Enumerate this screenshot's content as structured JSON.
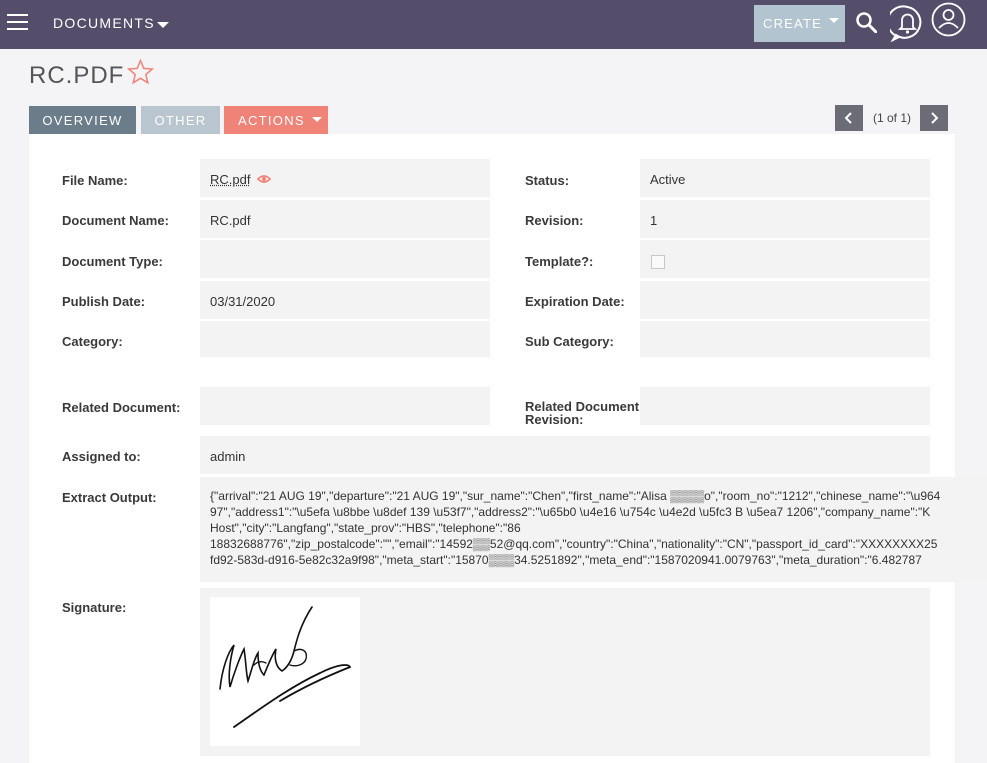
{
  "topbar": {
    "module_label": "DOCUMENTS",
    "create_label": "CREATE"
  },
  "record": {
    "title": "RC.PDF"
  },
  "tabs": {
    "overview": "OVERVIEW",
    "other": "OTHER",
    "actions": "ACTIONS"
  },
  "pager": {
    "text": "(1 of 1)"
  },
  "fields": {
    "file_name": {
      "label": "File Name:",
      "value": "RC.pdf"
    },
    "status": {
      "label": "Status:",
      "value": "Active"
    },
    "document_name": {
      "label": "Document Name:",
      "value": "RC.pdf"
    },
    "revision": {
      "label": "Revision:",
      "value": "1"
    },
    "document_type": {
      "label": "Document Type:",
      "value": ""
    },
    "template": {
      "label": "Template?:",
      "checked": false
    },
    "publish_date": {
      "label": "Publish Date:",
      "value": "03/31/2020"
    },
    "expiration_date": {
      "label": "Expiration Date:",
      "value": ""
    },
    "category": {
      "label": "Category:",
      "value": ""
    },
    "sub_category": {
      "label": "Sub Category:",
      "value": ""
    },
    "related_document": {
      "label": "Related Document:",
      "value": ""
    },
    "related_document_revision": {
      "label_line1": "Related Document",
      "label_line2": "Revision:",
      "value": ""
    },
    "assigned_to": {
      "label": "Assigned to:",
      "value": "admin"
    },
    "extract_output": {
      "label": "Extract Output:",
      "lines": [
        "{\"arrival\":\"21 AUG 19\",\"departure\":\"21 AUG 19\",\"sur_name\":\"Chen\",\"first_name\":\"Alisa ▒▒▒▒o\",\"room_no\":\"1212\",\"chinese_name\":\"\\u964",
        "97\",\"address1\":\"\\u5efa \\u8bbe \\u8def 139 \\u53f7\",\"address2\":\"\\u65b0 \\u4e16 \\u754c \\u4e2d \\u5fc3 B \\u5ea7 1206\",\"company_name\":\"K",
        "Host\",\"city\":\"Langfang\",\"state_prov\":\"HBS\",\"telephone\":\"86",
        "18832688776\",\"zip_postalcode\":\"\",\"email\":\"14592▒▒52@qq.com\",\"country\":\"China\",\"nationality\":\"CN\",\"passport_id_card\":\"XXXXXXXX25",
        "fd92-583d-d916-5e82c32a9f98\",\"meta_start\":\"15870▒▒▒34.5251892\",\"meta_end\":\"1587020941.0079763\",\"meta_duration\":\"6.482787"
      ]
    },
    "signature": {
      "label": "Signature:"
    }
  }
}
